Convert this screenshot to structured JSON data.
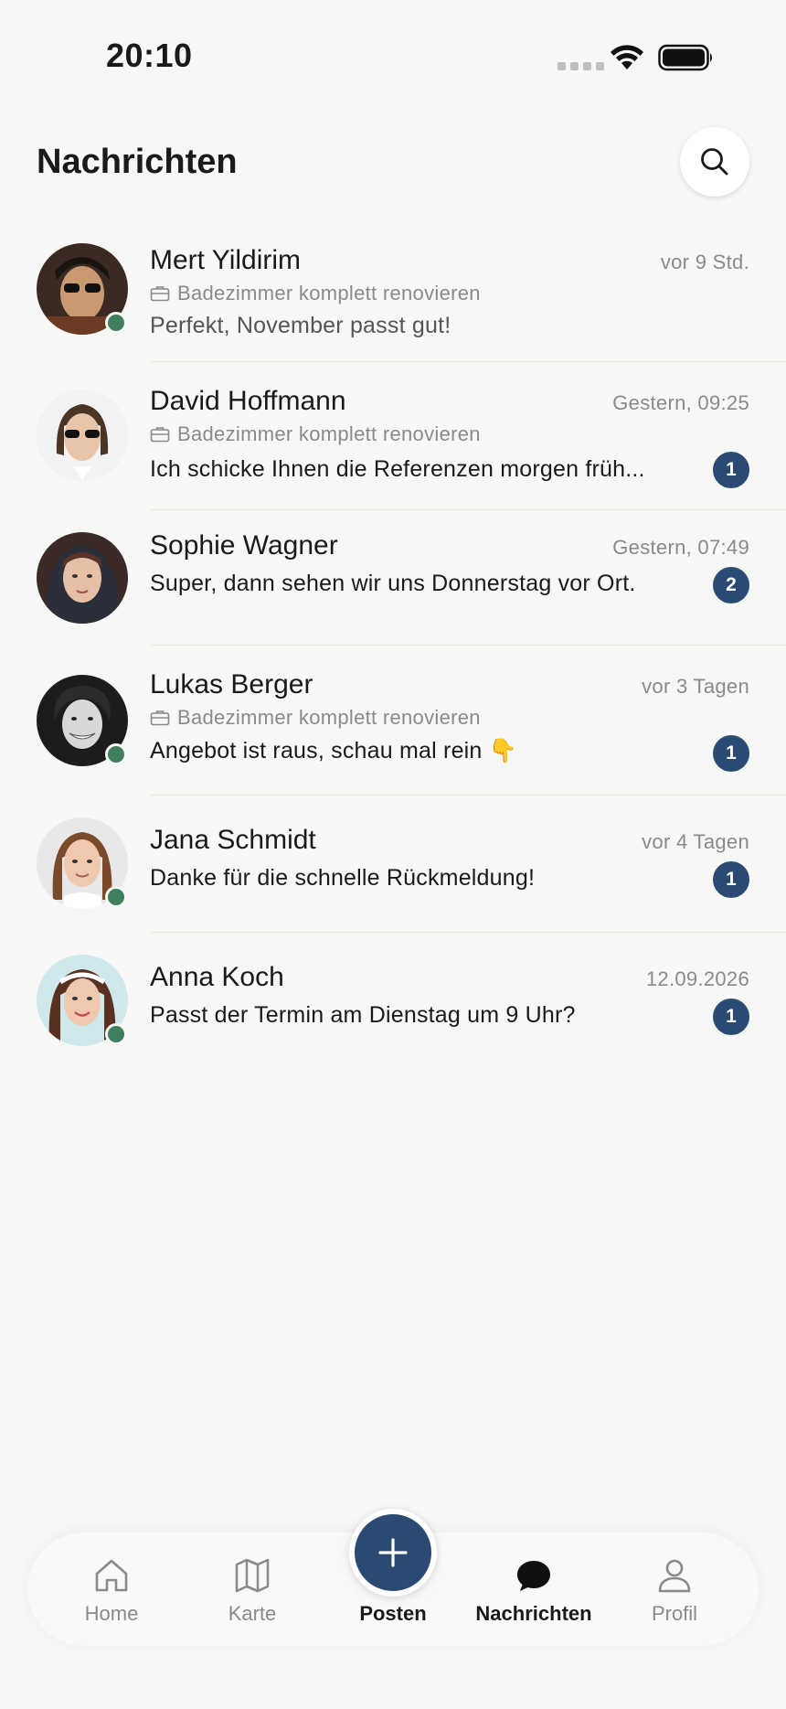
{
  "status_bar": {
    "time": "20:10"
  },
  "header": {
    "title": "Nachrichten"
  },
  "conversations": [
    {
      "name": "Mert Yildirim",
      "time": "vor 9 Std.",
      "project": "Badezimmer komplett renovieren",
      "preview": "Perfekt, November passt gut!",
      "unread": "",
      "online": true
    },
    {
      "name": "David Hoffmann",
      "time": "Gestern, 09:25",
      "project": "Badezimmer komplett renovieren",
      "preview": "Ich schicke Ihnen die Referenzen morgen früh...",
      "unread": "1",
      "online": false
    },
    {
      "name": "Sophie Wagner",
      "time": "Gestern, 07:49",
      "project": "",
      "preview": "Super, dann sehen wir uns Donnerstag vor Ort.",
      "unread": "2",
      "online": false
    },
    {
      "name": "Lukas Berger",
      "time": "vor 3 Tagen",
      "project": "Badezimmer komplett renovieren",
      "preview": "Angebot ist raus, schau mal rein 👇",
      "unread": "1",
      "online": true
    },
    {
      "name": "Jana Schmidt",
      "time": "vor 4 Tagen",
      "project": "",
      "preview": "Danke für die schnelle Rückmeldung!",
      "unread": "1",
      "online": true
    },
    {
      "name": "Anna Koch",
      "time": "12.09.2026",
      "project": "",
      "preview": "Passt der Termin am Dienstag um 9 Uhr?",
      "unread": "1",
      "online": true
    }
  ],
  "nav": {
    "home": "Home",
    "map": "Karte",
    "post": "Posten",
    "messages": "Nachrichten",
    "profile": "Profil"
  },
  "colors": {
    "accent": "#2a4a73",
    "online": "#3f7f5c",
    "muted": "#8a8a8a",
    "background": "#f7f7f5"
  }
}
